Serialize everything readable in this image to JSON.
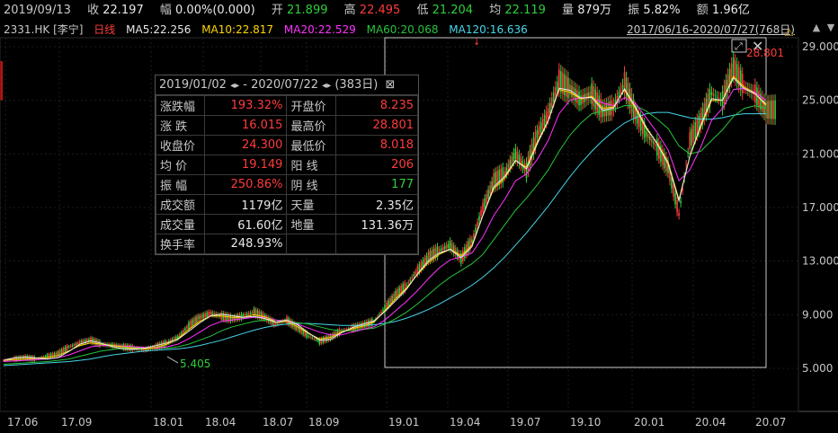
{
  "header": {
    "date": "2019/09/13",
    "close_label": "收",
    "close_value": "22.197",
    "change_label": "幅",
    "change_value": "0.00%(0.000)",
    "open_label": "开",
    "open_value": "21.899",
    "high_label": "高",
    "high_value": "22.495",
    "low_label": "低",
    "low_value": "21.204",
    "avg_label": "均",
    "avg_value": "22.119",
    "vol_label": "量",
    "vol_value": "879万",
    "amp_label": "振",
    "amp_value": "5.82%",
    "amt_label": "额",
    "amt_value": "1.96亿"
  },
  "ma": {
    "ticker": "2331.HK",
    "name": "[李宁]",
    "period": "日线",
    "ma5": "MA5:22.256",
    "ma10": "MA10:22.817",
    "ma20": "MA20:22.529",
    "ma60": "MA60:20.068",
    "ma120": "MA120:16.636",
    "range": "2017/06/16-2020/07/27(768日)"
  },
  "stats": {
    "range_start": "2019/01/02",
    "range_end": "- 2020/07/22",
    "days": "(383日)",
    "rows": [
      {
        "l1": "涨跌幅",
        "v1": "193.32%",
        "c1": "red",
        "l2": "开盘价",
        "v2": "8.235",
        "c2": "red"
      },
      {
        "l1": "涨  跌",
        "v1": "16.015",
        "c1": "red",
        "l2": "最高价",
        "v2": "28.801",
        "c2": "red"
      },
      {
        "l1": "收盘价",
        "v1": "24.300",
        "c1": "red",
        "l2": "最低价",
        "v2": "8.018",
        "c2": "red"
      },
      {
        "l1": "均  价",
        "v1": "19.149",
        "c1": "red",
        "l2": "阳  线",
        "v2": "206",
        "c2": "red"
      },
      {
        "l1": "振  幅",
        "v1": "250.86%",
        "c1": "red",
        "l2": "阴  线",
        "v2": "177",
        "c2": "green"
      },
      {
        "l1": "成交额",
        "v1": "1179亿",
        "c1": "white",
        "l2": "天量",
        "v2": "2.35亿",
        "c2": "white"
      },
      {
        "l1": "成交量",
        "v1": "61.60亿",
        "c1": "white",
        "l2": "地量",
        "v2": "131.36万",
        "c2": "white"
      },
      {
        "l1": "换手率",
        "v1": "248.93%",
        "c1": "white",
        "l2": "",
        "v2": "",
        "c2": "white"
      }
    ]
  },
  "chart_data": {
    "type": "line",
    "y_ticks": [
      "29.000",
      "25.000",
      "21.000",
      "17.000",
      "13.000",
      "9.000",
      "5.000"
    ],
    "y_tick_values": [
      29,
      25,
      21,
      17,
      13,
      9,
      5
    ],
    "x_ticks": [
      "17.06",
      "17.09",
      "18.01",
      "18.04",
      "18.07",
      "18.09",
      "19.01",
      "19.04",
      "19.07",
      "19.10",
      "20.01",
      "20.04",
      "20.07"
    ],
    "ylim": [
      5,
      29
    ],
    "annotations": {
      "high_label": "28.801",
      "low_label": "5.405"
    },
    "price_series": [
      5.6,
      5.7,
      5.8,
      5.7,
      5.9,
      6.1,
      6.6,
      6.9,
      7.1,
      6.8,
      6.7,
      6.6,
      6.5,
      6.4,
      6.6,
      6.9,
      7.3,
      8.2,
      8.8,
      9.1,
      8.9,
      8.7,
      8.9,
      9.2,
      8.8,
      8.3,
      8.6,
      8.0,
      7.4,
      7.0,
      7.3,
      7.8,
      8.0,
      8.2,
      8.5,
      9.5,
      10.5,
      11.2,
      12.3,
      13.3,
      13.8,
      14.2,
      13.2,
      14.5,
      17.0,
      19.0,
      19.5,
      21.0,
      19.8,
      22.5,
      24.0,
      26.5,
      25.8,
      25.0,
      25.5,
      24.2,
      24.5,
      26.3,
      24.0,
      22.5,
      21.5,
      20.0,
      16.5,
      22.0,
      23.5,
      25.5,
      25.0,
      27.5,
      26.0,
      25.5,
      24.3
    ],
    "ma5": [
      5.6,
      5.65,
      5.7,
      5.75,
      5.8,
      5.95,
      6.3,
      6.7,
      6.9,
      6.8,
      6.7,
      6.6,
      6.5,
      6.45,
      6.55,
      6.8,
      7.2,
      7.9,
      8.5,
      8.9,
      8.9,
      8.8,
      8.8,
      9.0,
      8.85,
      8.45,
      8.5,
      8.1,
      7.6,
      7.2,
      7.3,
      7.7,
      7.95,
      8.15,
      8.45,
      9.3,
      10.2,
      11.0,
      12.0,
      12.9,
      13.5,
      13.9,
      13.4,
      14.2,
      16.4,
      18.4,
      19.2,
      20.5,
      20.0,
      21.9,
      23.5,
      25.8,
      25.6,
      25.1,
      25.3,
      24.4,
      24.5,
      25.8,
      24.4,
      22.9,
      21.8,
      20.4,
      17.6,
      20.8,
      23.0,
      25.0,
      25.0,
      26.8,
      26.0,
      25.5,
      24.6
    ],
    "ma20": [
      5.5,
      5.55,
      5.6,
      5.65,
      5.7,
      5.8,
      6.0,
      6.3,
      6.6,
      6.7,
      6.7,
      6.65,
      6.6,
      6.55,
      6.5,
      6.6,
      6.8,
      7.2,
      7.7,
      8.2,
      8.5,
      8.6,
      8.7,
      8.8,
      8.8,
      8.6,
      8.5,
      8.3,
      8.0,
      7.7,
      7.5,
      7.5,
      7.7,
      7.9,
      8.1,
      8.6,
      9.3,
      10.0,
      10.8,
      11.7,
      12.5,
      13.1,
      13.3,
      13.6,
      14.8,
      16.4,
      17.6,
      19.0,
      19.5,
      20.6,
      22.0,
      24.0,
      25.0,
      25.2,
      25.2,
      24.8,
      24.6,
      25.2,
      24.8,
      23.7,
      22.6,
      21.3,
      19.0,
      19.8,
      21.5,
      23.5,
      24.4,
      25.8,
      25.9,
      25.6,
      25.0
    ],
    "ma60": [
      5.3,
      5.35,
      5.4,
      5.45,
      5.5,
      5.6,
      5.7,
      5.9,
      6.1,
      6.3,
      6.4,
      6.5,
      6.55,
      6.5,
      6.5,
      6.5,
      6.6,
      6.8,
      7.1,
      7.4,
      7.8,
      8.1,
      8.3,
      8.5,
      8.6,
      8.6,
      8.5,
      8.4,
      8.3,
      8.1,
      7.9,
      7.8,
      7.8,
      7.9,
      8.0,
      8.3,
      8.7,
      9.2,
      9.8,
      10.5,
      11.2,
      11.8,
      12.3,
      12.8,
      13.5,
      14.6,
      15.7,
      16.8,
      17.7,
      18.7,
      19.8,
      21.2,
      22.4,
      23.3,
      24.0,
      24.2,
      24.3,
      24.6,
      24.6,
      24.2,
      23.6,
      22.9,
      21.6,
      21.0,
      21.2,
      22.0,
      22.8,
      23.8,
      24.4,
      24.6,
      24.4
    ],
    "ma120": [
      5.2,
      5.25,
      5.3,
      5.35,
      5.4,
      5.45,
      5.5,
      5.6,
      5.7,
      5.85,
      6.0,
      6.1,
      6.2,
      6.3,
      6.35,
      6.4,
      6.45,
      6.55,
      6.7,
      6.9,
      7.1,
      7.35,
      7.6,
      7.85,
      8.05,
      8.2,
      8.3,
      8.35,
      8.35,
      8.3,
      8.25,
      8.2,
      8.2,
      8.2,
      8.25,
      8.35,
      8.5,
      8.75,
      9.05,
      9.4,
      9.8,
      10.25,
      10.7,
      11.2,
      11.8,
      12.5,
      13.3,
      14.2,
      15.1,
      16.1,
      17.1,
      18.2,
      19.3,
      20.3,
      21.2,
      22.0,
      22.7,
      23.3,
      23.7,
      24.0,
      24.1,
      24.1,
      23.9,
      23.7,
      23.6,
      23.6,
      23.7,
      23.9,
      24.0,
      24.0,
      24.0
    ]
  },
  "colors": {
    "up": "#ff3b3b",
    "down": "#2fcf3a",
    "ma5": "#e8e8e8",
    "ma10": "#ffd700",
    "ma20": "#ff33ff",
    "ma60": "#27c43a",
    "ma120": "#46d6e8"
  }
}
